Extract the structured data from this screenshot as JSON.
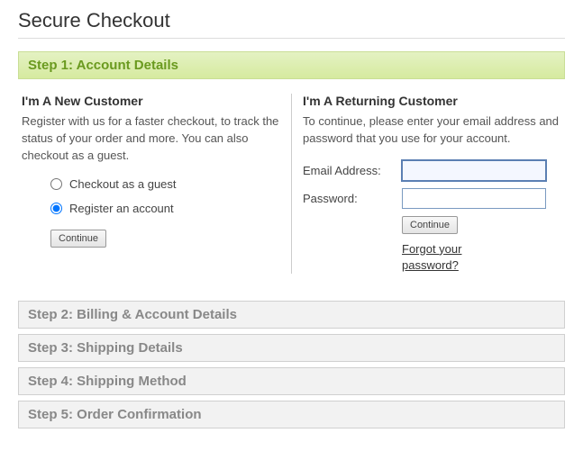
{
  "page_title": "Secure Checkout",
  "steps": [
    {
      "label": "Step 1: Account Details",
      "active": true
    },
    {
      "label": "Step 2: Billing & Account Details",
      "active": false
    },
    {
      "label": "Step 3: Shipping Details",
      "active": false
    },
    {
      "label": "Step 4: Shipping Method",
      "active": false
    },
    {
      "label": "Step 5: Order Confirmation",
      "active": false
    }
  ],
  "new_customer": {
    "heading": "I'm A New Customer",
    "description": "Register with us for a faster checkout, to track the status of your order and more. You can also checkout as a guest.",
    "options": {
      "guest": "Checkout as a guest",
      "register": "Register an account"
    },
    "selected": "register",
    "continue_label": "Continue"
  },
  "returning_customer": {
    "heading": "I'm A Returning Customer",
    "description": "To continue, please enter your email address and password that you use for your account.",
    "email_label": "Email Address:",
    "email_value": "",
    "password_label": "Password:",
    "password_value": "",
    "continue_label": "Continue",
    "forgot_label": "Forgot your password?"
  }
}
